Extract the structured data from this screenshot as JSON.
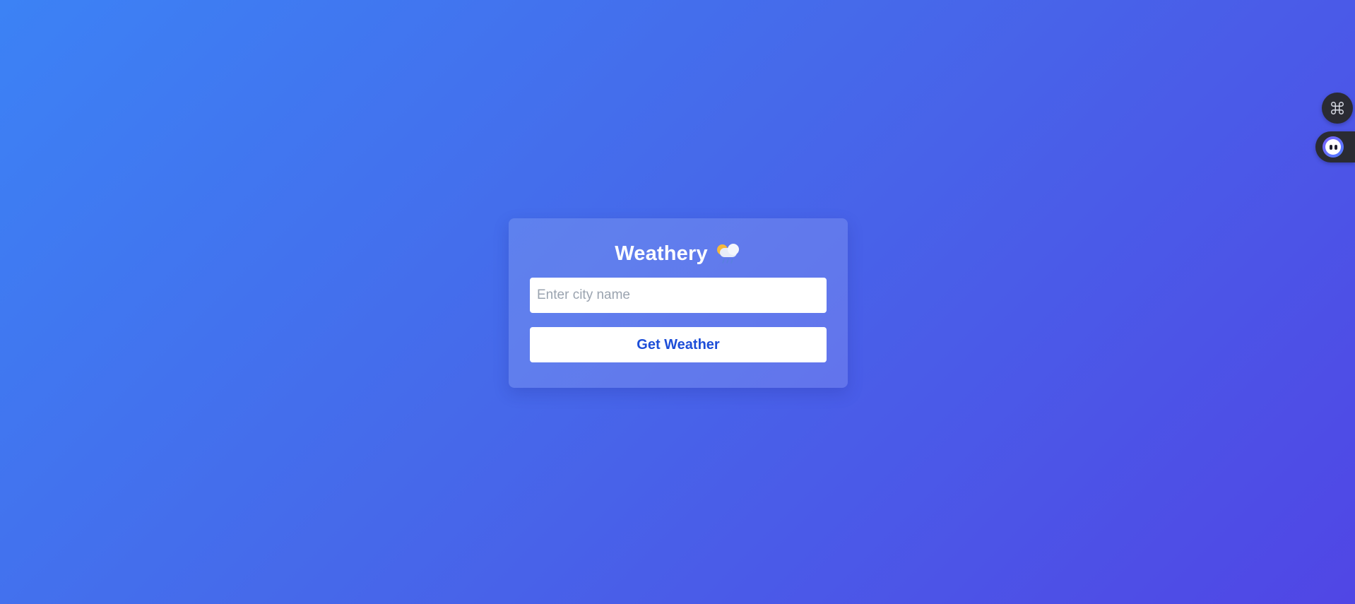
{
  "app": {
    "title": "Weathery"
  },
  "search": {
    "placeholder": "Enter city name",
    "value": ""
  },
  "actions": {
    "get_weather_label": "Get Weather"
  },
  "icons": {
    "title_icon": "sun-behind-rain-cloud-icon",
    "command_widget": "command-key-icon",
    "assistant_widget": "assistant-face-icon"
  },
  "colors": {
    "background_start": "#3c82f5",
    "background_end": "#5046e5",
    "button_text": "#1d4ed8",
    "widget_bg": "#2a2b33"
  }
}
